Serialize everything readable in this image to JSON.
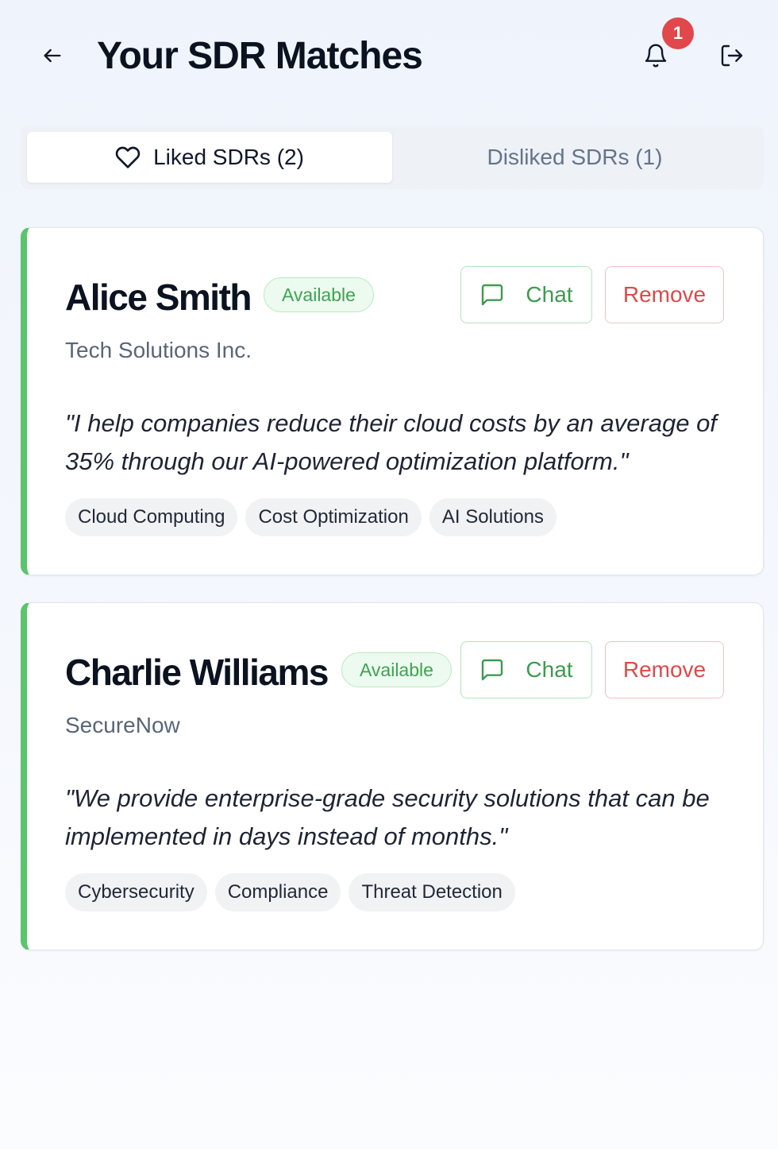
{
  "header": {
    "title": "Your SDR Matches",
    "back_icon": "arrow-left-icon",
    "bell_icon": "bell-icon",
    "notification_count": "1",
    "logout_icon": "logout-icon"
  },
  "tabs": [
    {
      "label": "Liked SDRs (2)",
      "icon": "heart-icon",
      "active": true
    },
    {
      "label": "Disliked SDRs (1)",
      "active": false
    }
  ],
  "sdrs": [
    {
      "name": "Alice Smith",
      "status": "Available",
      "company": "Tech Solutions Inc.",
      "pitch": "\"I help companies reduce their cloud costs by an average of 35% through our AI-powered optimization platform.\"",
      "tags": [
        "Cloud Computing",
        "Cost Optimization",
        "AI Solutions"
      ],
      "chat_label": "Chat",
      "remove_label": "Remove"
    },
    {
      "name": "Charlie Williams",
      "status": "Available",
      "company": "SecureNow",
      "pitch": "\"We provide enterprise-grade security solutions that can be implemented in days instead of months.\"",
      "tags": [
        "Cybersecurity",
        "Compliance",
        "Threat Detection"
      ],
      "chat_label": "Chat",
      "remove_label": "Remove"
    }
  ],
  "colors": {
    "accent_green": "#5bc46d",
    "remove_red": "#dc4a4a",
    "badge_red": "#e0484b"
  }
}
